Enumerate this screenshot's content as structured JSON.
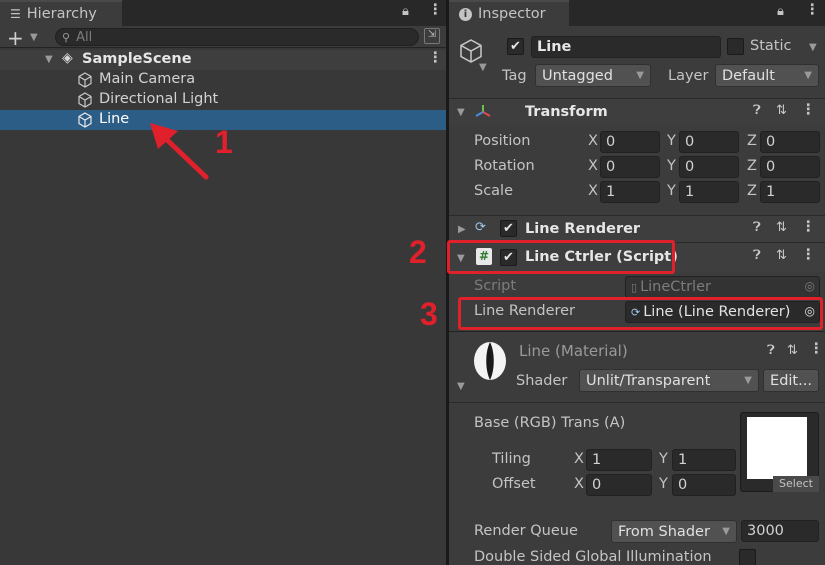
{
  "hierarchy": {
    "tab_label": "Hierarchy",
    "search_placeholder": "All",
    "scene": "SampleScene",
    "items": [
      "Main Camera",
      "Directional Light",
      "Line"
    ]
  },
  "inspector": {
    "tab_label": "Inspector",
    "object_name": "Line",
    "static_label": "Static",
    "tag_label": "Tag",
    "tag_value": "Untagged",
    "layer_label": "Layer",
    "layer_value": "Default",
    "transform": {
      "title": "Transform",
      "rows": [
        {
          "label": "Position",
          "x": "0",
          "y": "0",
          "z": "0"
        },
        {
          "label": "Rotation",
          "x": "0",
          "y": "0",
          "z": "0"
        },
        {
          "label": "Scale",
          "x": "1",
          "y": "1",
          "z": "1"
        }
      ],
      "axis_x": "X",
      "axis_y": "Y",
      "axis_z": "Z"
    },
    "line_renderer": {
      "title": "Line Renderer"
    },
    "script_component": {
      "title": "Line Ctrler (Script)",
      "script_label": "Script",
      "script_value": "LineCtrler",
      "field_label": "Line Renderer",
      "field_value": "Line (Line Renderer)"
    },
    "material": {
      "title": "Line (Material)",
      "shader_label": "Shader",
      "shader_value": "Unlit/Transparent",
      "edit_label": "Edit...",
      "base_label": "Base (RGB) Trans (A)",
      "tiling_label": "Tiling",
      "tiling_x": "1",
      "tiling_y": "1",
      "offset_label": "Offset",
      "offset_x": "0",
      "offset_y": "0",
      "select_label": "Select",
      "render_queue_label": "Render Queue",
      "render_queue_dropdown": "From Shader",
      "render_queue_value": "3000",
      "dsgi_label": "Double Sided Global Illumination"
    }
  },
  "annotations": [
    "1",
    "2",
    "3"
  ],
  "colors": {
    "selection": "#2c5d87",
    "annotation": "#e0202b",
    "panel": "#383838"
  }
}
